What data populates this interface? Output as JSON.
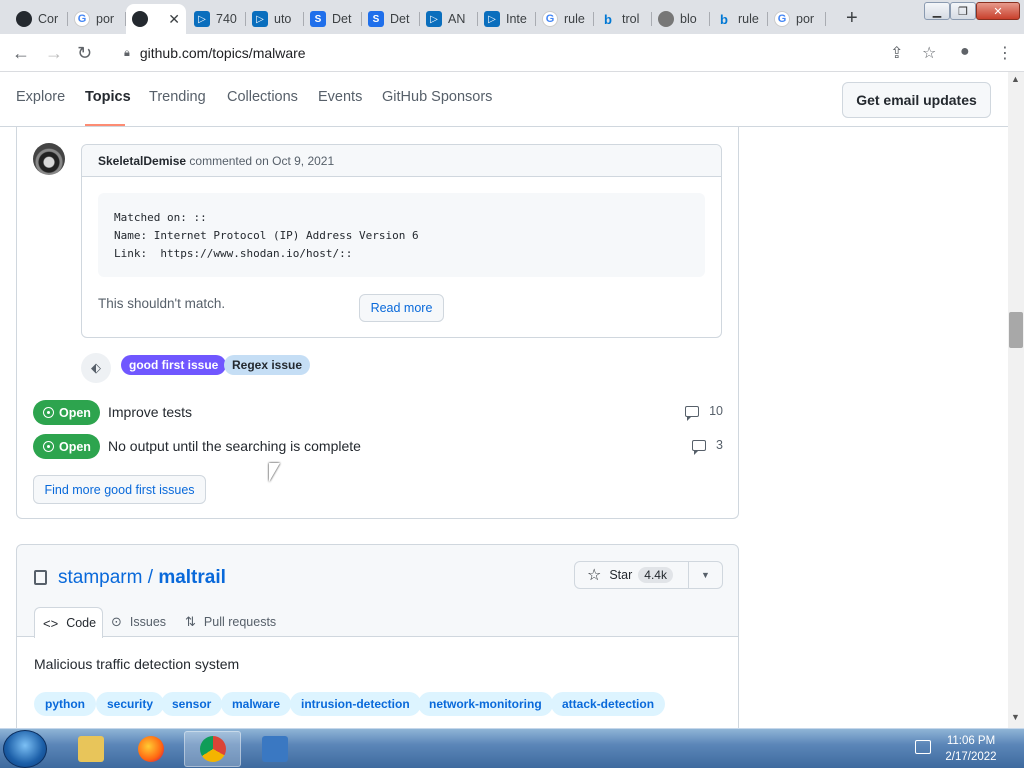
{
  "browser": {
    "tabs": [
      {
        "label": "Cor",
        "icon": "github-logo-icon"
      },
      {
        "label": "por",
        "icon": "google-icon"
      },
      {
        "label": "",
        "icon": "github-icon",
        "active": true
      },
      {
        "label": "740",
        "icon": "microsoft-icon"
      },
      {
        "label": "uto",
        "icon": "microsoft-icon"
      },
      {
        "label": "Det",
        "icon": "s-icon"
      },
      {
        "label": "Det",
        "icon": "s-icon"
      },
      {
        "label": "AN",
        "icon": "microsoft-icon"
      },
      {
        "label": "Inte",
        "icon": "microsoft-icon"
      },
      {
        "label": "rule",
        "icon": "google-icon"
      },
      {
        "label": "trol",
        "icon": "bing-icon"
      },
      {
        "label": "blo",
        "icon": "globe-icon"
      },
      {
        "label": "rule",
        "icon": "bing-icon"
      },
      {
        "label": "por",
        "icon": "google-icon"
      }
    ],
    "close_glyph": "✕",
    "new_tab_glyph": "+",
    "url": "github.com/topics/malware"
  },
  "github_nav": {
    "items": [
      "Explore",
      "Topics",
      "Trending",
      "Collections",
      "Events",
      "GitHub Sponsors"
    ],
    "active": "Topics",
    "email_button": "Get email updates"
  },
  "issue_card": {
    "comment": {
      "author": "SkeletalDemise",
      "meta": "commented on Oct 9, 2021",
      "code": "Matched on: ::\nName: Internet Protocol (IP) Address Version 6\nLink:  https://www.shodan.io/host/::",
      "body": "This shouldn't match.",
      "read_more": "Read more"
    },
    "labels": [
      {
        "text": "good first issue",
        "color": "#7057ff"
      },
      {
        "text": "Regex issue",
        "color": "#c5def5"
      }
    ],
    "issues": [
      {
        "status": "Open",
        "title": "Improve tests",
        "comments": "10"
      },
      {
        "status": "Open",
        "title": "No output until the searching is complete",
        "comments": "3"
      }
    ],
    "find_more": "Find more good first issues"
  },
  "repo_card": {
    "owner": "stamparm",
    "separator": " / ",
    "name": "maltrail",
    "star_label": "Star",
    "star_count": "4.4k",
    "tabs": [
      "Code",
      "Issues",
      "Pull requests"
    ],
    "description": "Malicious traffic detection system",
    "topics": [
      "python",
      "security",
      "sensor",
      "malware",
      "intrusion-detection",
      "network-monitoring",
      "attack-detection"
    ]
  },
  "taskbar": {
    "time": "11:06 PM",
    "date": "2/17/2022"
  },
  "colors": {
    "accent": "#0969da",
    "open_green": "#2da44e",
    "nav_underline": "#fd8c73"
  }
}
